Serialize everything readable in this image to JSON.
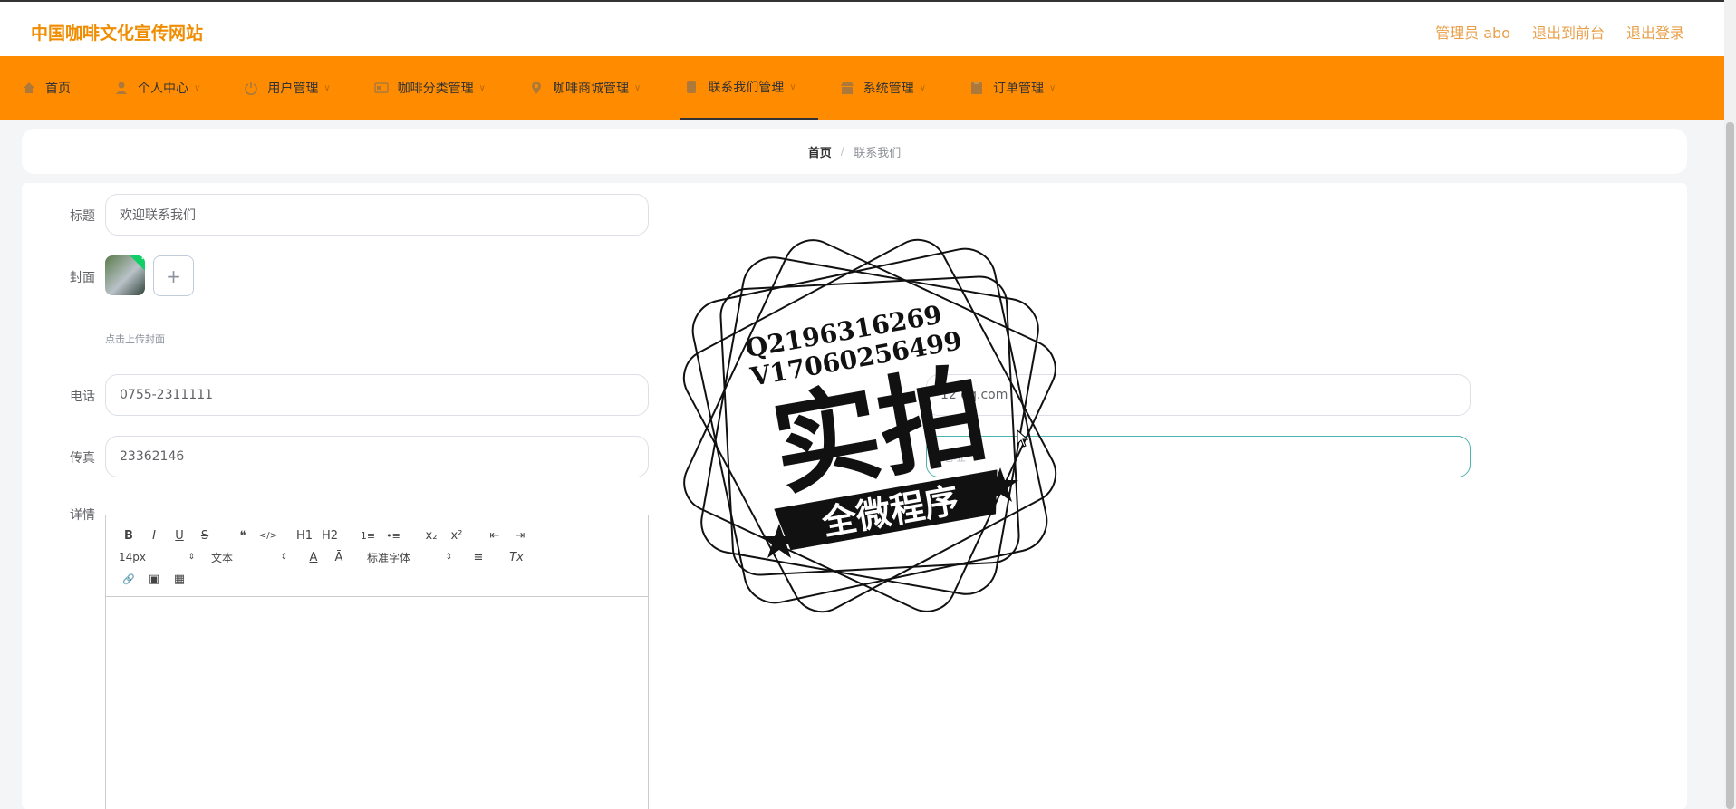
{
  "header": {
    "brand": "中国咖啡文化宣传网站",
    "links": [
      "管理员 abo",
      "退出到前台",
      "退出登录"
    ]
  },
  "nav": {
    "items": [
      {
        "label": "首页",
        "icon": "home-icon",
        "has_chevron": false
      },
      {
        "label": "个人中心",
        "icon": "user-icon",
        "has_chevron": true
      },
      {
        "label": "用户管理",
        "icon": "power-icon",
        "has_chevron": true
      },
      {
        "label": "咖啡分类管理",
        "icon": "card-icon",
        "has_chevron": true
      },
      {
        "label": "咖啡商城管理",
        "icon": "location-icon",
        "has_chevron": true
      },
      {
        "label": "联系我们管理",
        "icon": "document-icon",
        "has_chevron": true,
        "active": true
      },
      {
        "label": "系统管理",
        "icon": "shop-icon",
        "has_chevron": true
      },
      {
        "label": "订单管理",
        "icon": "order-icon",
        "has_chevron": true
      }
    ],
    "chevron": "∨"
  },
  "breadcrumb": {
    "home": "首页",
    "separator": "/",
    "current": "联系我们"
  },
  "form": {
    "title_label": "标题",
    "title_value": "欢迎联系我们",
    "cover_label": "封面",
    "cover_hint": "点击上传封面",
    "upload_plus": "+",
    "phone_label": "电话",
    "phone_value": "0755-2311111",
    "fax_label": "传真",
    "fax_value": "23362146",
    "email_value": "12  qq.com",
    "address_placeholder": "地址",
    "detail_label": "详情"
  },
  "editor": {
    "row1": [
      "B",
      "I",
      "U",
      "S",
      "❝",
      "</>",
      "H1",
      "H2",
      "1≡",
      "•≡",
      "x₂",
      "x²",
      "⇤",
      "⇥"
    ],
    "size_select": "14px",
    "header_select": "文本",
    "font_select": "标准字体",
    "row2_icons": [
      "A",
      "Ā",
      "≡",
      "Tx"
    ],
    "row3": [
      "🔗",
      "▣",
      "▦"
    ]
  },
  "watermark": {
    "qq": "Q2196316269",
    "wechat": "V17060256499",
    "main": "实拍",
    "ribbon": "全微程序"
  },
  "colors": {
    "accent": "#ff8c00",
    "brand": "#f08c00",
    "focus_border": "#4db3b0"
  }
}
